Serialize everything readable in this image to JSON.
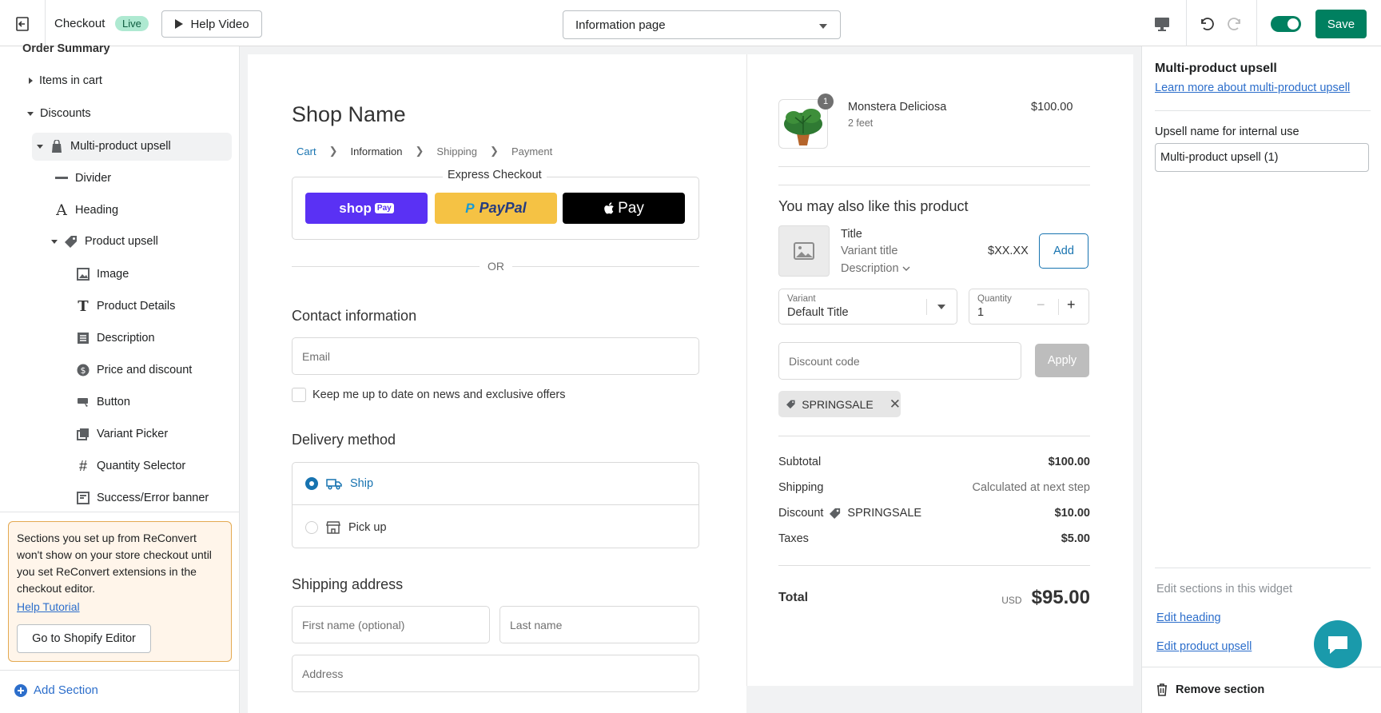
{
  "topbar": {
    "title": "Checkout",
    "live_badge": "Live",
    "help_video": "Help Video",
    "page_select": "Information page",
    "save": "Save"
  },
  "left": {
    "order_summary": "Order Summary",
    "items": [
      {
        "label": "Items in cart"
      },
      {
        "label": "Discounts"
      },
      {
        "label": "Multi-product upsell"
      },
      {
        "label": "Divider"
      },
      {
        "label": "Heading"
      },
      {
        "label": "Product upsell"
      },
      {
        "label": "Image"
      },
      {
        "label": "Product Details"
      },
      {
        "label": "Description"
      },
      {
        "label": "Price and discount"
      },
      {
        "label": "Button"
      },
      {
        "label": "Variant Picker"
      },
      {
        "label": "Quantity Selector"
      },
      {
        "label": "Success/Error banner"
      }
    ],
    "notice": "Sections you set up from ReConvert won't show on your store checkout until you set ReConvert extensions in the checkout editor.",
    "help_tutorial": "Help Tutorial",
    "go_shopify": "Go to Shopify Editor",
    "add_section": "Add Section"
  },
  "checkout": {
    "shop_name": "Shop Name",
    "crumbs": [
      "Cart",
      "Information",
      "Shipping",
      "Payment"
    ],
    "express_title": "Express Checkout",
    "shop_pay": "shop",
    "shop_pay_tag": "Pay",
    "paypal": "PayPal",
    "apple_pay": "Pay",
    "or": "OR",
    "contact_heading": "Contact information",
    "email_placeholder": "Email",
    "newsletter": "Keep me up to date on news and exclusive offers",
    "delivery_heading": "Delivery method",
    "ship": "Ship",
    "pickup": "Pick up",
    "shipping_heading": "Shipping address",
    "first_name": "First name (optional)",
    "last_name": "Last name",
    "address": "Address"
  },
  "summary": {
    "product_name": "Monstera Deliciosa",
    "product_variant": "2 feet",
    "product_price": "$100.00",
    "product_qty": "1",
    "upsell_heading": "You may also like this product",
    "upsell_title": "Title",
    "upsell_variant": "Variant title",
    "upsell_desc": "Description",
    "upsell_price": "$XX.XX",
    "add": "Add",
    "variant_label": "Variant",
    "variant_value": "Default Title",
    "qty_label": "Quantity",
    "qty_value": "1",
    "discount_placeholder": "Discount code",
    "apply": "Apply",
    "discount_tag": "SPRINGSALE",
    "subtotal_label": "Subtotal",
    "subtotal": "$100.00",
    "shipping_label": "Shipping",
    "shipping": "Calculated at next step",
    "discount_label": "Discount",
    "discount_code": "SPRINGSALE",
    "discount": "$10.00",
    "taxes_label": "Taxes",
    "taxes": "$5.00",
    "total_label": "Total",
    "currency": "USD",
    "total": "$95.00"
  },
  "right": {
    "heading": "Multi-product upsell",
    "learn_more": "Learn more about multi-product upsell",
    "name_label": "Upsell name for internal use",
    "name_value": "Multi-product upsell (1)",
    "edit_sections": "Edit sections in this widget",
    "edit_heading": "Edit heading",
    "edit_product": "Edit product upsell",
    "remove": "Remove section"
  },
  "colors": {
    "accent": "#008060",
    "link": "#2c6ecb",
    "checkout_link": "#1773b0"
  }
}
